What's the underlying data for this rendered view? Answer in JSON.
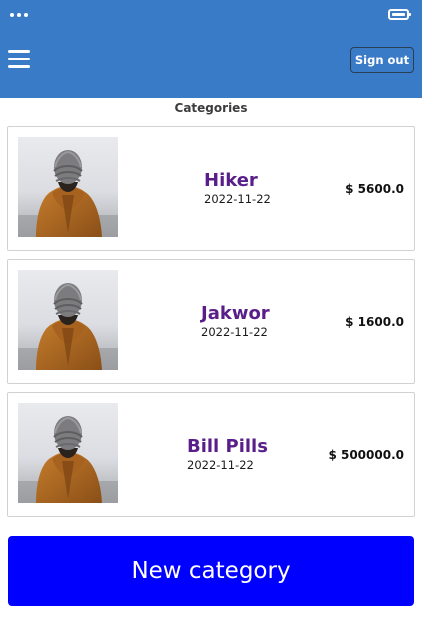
{
  "header": {
    "status_dots_icon": "ellipsis-icon",
    "battery_icon": "battery-icon",
    "menu_icon": "hamburger-menu-icon",
    "signout_label": "Sign out",
    "bar_color": "#3a7bc8"
  },
  "page": {
    "title": "Categories"
  },
  "categories": [
    {
      "name": "Hiker",
      "date": "2022-11-22",
      "price": "$ 5600.0"
    },
    {
      "name": "Jakwor",
      "date": "2022-11-22",
      "price": "$ 1600.0"
    },
    {
      "name": "Bill Pills",
      "date": "2022-11-22",
      "price": "$ 500000.0"
    }
  ],
  "footer": {
    "new_category_label": "New category",
    "button_color": "#0000ff"
  }
}
